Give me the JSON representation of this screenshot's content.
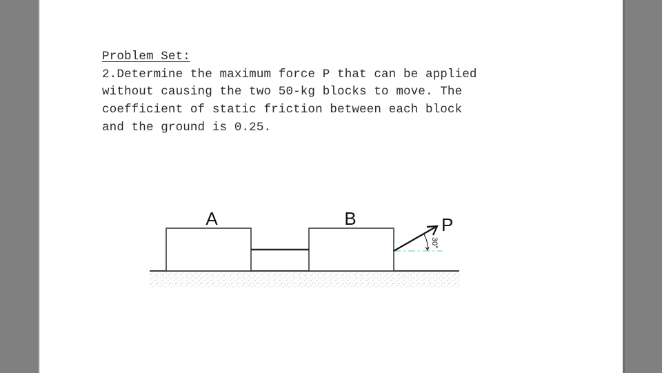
{
  "document": {
    "heading": "Problem Set:",
    "problem_lines": [
      "2.Determine the maximum force P that can be applied",
      "without causing the two 50-kg blocks to move. The",
      "coefficient of static friction between each block",
      "and the ground is 0.25."
    ]
  },
  "figure": {
    "block_a_label": "A",
    "block_b_label": "B",
    "force_label": "P",
    "angle_label": "30°",
    "colors": {
      "line": "#3a3a3a",
      "reference_dash": "#6fd6e0"
    }
  }
}
